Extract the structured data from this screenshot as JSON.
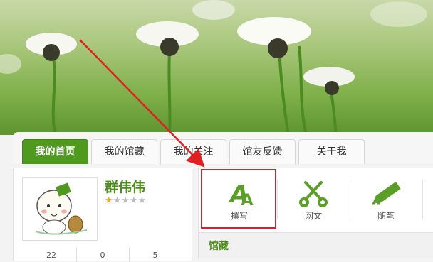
{
  "tabs": [
    {
      "label": "我的首页",
      "active": true
    },
    {
      "label": "我的馆藏",
      "active": false
    },
    {
      "label": "我的关注",
      "active": false
    },
    {
      "label": "馆友反馈",
      "active": false
    },
    {
      "label": "关于我",
      "active": false
    }
  ],
  "profile": {
    "name": "群伟伟",
    "rating_stars_filled": 1,
    "rating_stars_total": 5,
    "stats": [
      "22",
      "0",
      "5"
    ]
  },
  "tools": [
    {
      "label": "撰写",
      "icon": "write-icon"
    },
    {
      "label": "网文",
      "icon": "scissors-icon"
    },
    {
      "label": "随笔",
      "icon": "pencil-icon"
    }
  ],
  "collection": {
    "title": "馆藏"
  },
  "colors": {
    "accent": "#4f9a1e",
    "highlight": "#e02020"
  }
}
